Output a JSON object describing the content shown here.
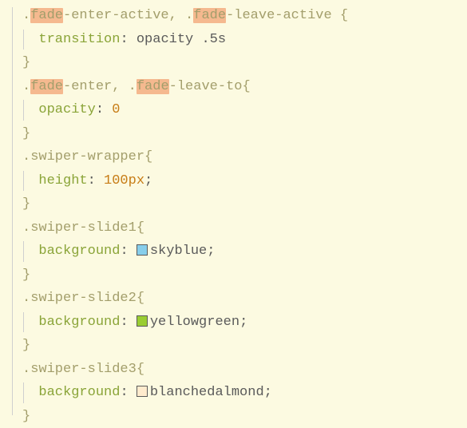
{
  "fade_word": "fade",
  "rules": {
    "r1": {
      "selector_parts": [
        "-enter-active, .",
        "-leave-active {"
      ],
      "prop": "transition",
      "value": "opacity .5s"
    },
    "r2": {
      "selector_parts": [
        "-enter, .",
        "-leave-to{"
      ],
      "prop": "opacity",
      "value": "0"
    },
    "r3": {
      "selector": ".swiper-wrapper{",
      "prop": "height",
      "value": "100px",
      "semicolon": ";"
    },
    "r4": {
      "selector": ".swiper-slide1{",
      "prop": "background",
      "value_name": "skyblue",
      "swatch_color": "#87ceeb"
    },
    "r5": {
      "selector": ".swiper-slide2{",
      "prop": "background",
      "value_name": "yellowgreen",
      "swatch_color": "#9acd32"
    },
    "r6": {
      "selector": ".swiper-slide3{",
      "prop": "background",
      "value_name": "blanchedalmond",
      "swatch_color": "#ffebcd"
    }
  },
  "brace_close": "}",
  "colon_space": ": ",
  "dot": ".",
  "semicolon": ";"
}
